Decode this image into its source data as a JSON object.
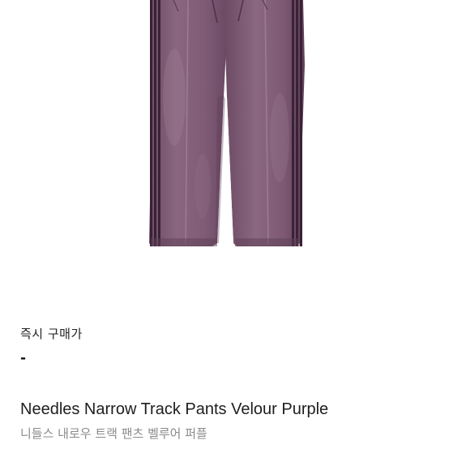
{
  "product": {
    "image": "product-photo",
    "buy_now_label": "즉시 구매가",
    "price": "-",
    "name_en": "Needles Narrow Track Pants Velour Purple",
    "name_kr": "니들스 내로우 트랙 팬츠 벨루어 퍼플"
  },
  "colors": {
    "velour": "#7d5a73",
    "velour_light": "#8e6a84",
    "velour_dark": "#5e3f56",
    "stripe": "#3a2236",
    "text_primary": "#1e1e1e",
    "text_secondary": "#8b8b8b"
  }
}
